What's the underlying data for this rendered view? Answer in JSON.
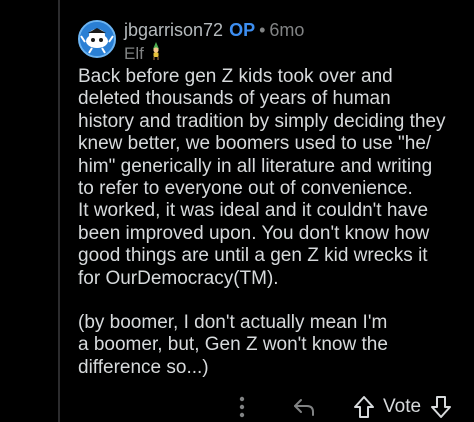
{
  "comment": {
    "username": "jbgarrison72",
    "op_badge": "OP",
    "separator": "•",
    "age": "6mo",
    "flair_text": "Elf",
    "flair_icon": "elf-emoji-icon",
    "paragraphs": [
      "Back before gen Z kids took over and\ndeleted thousands of years of human\nhistory and tradition by simply deciding they\nknew better, we boomers used to use \"he/\nhim\" generically in all literature and writing\nto refer to everyone out of convenience.\nIt worked, it was ideal and it couldn't have\nbeen improved upon. You don't know how\ngood things are until a gen Z kid wrecks it\nfor OurDemocracy(TM).",
      "(by boomer, I don't actually mean I'm\na boomer, but, Gen Z won't know the\ndifference so...)"
    ]
  },
  "actions": {
    "more_icon": "more-vertical-icon",
    "reply_icon": "reply-arrow-icon",
    "upvote_icon": "upvote-arrow-icon",
    "vote_label": "Vote",
    "downvote_icon": "downvote-arrow-icon"
  },
  "colors": {
    "background": "#000000",
    "text": "#d7dadc",
    "muted": "#818384",
    "op_accent": "#3d8ef0",
    "avatar": "#2a7fd4"
  }
}
